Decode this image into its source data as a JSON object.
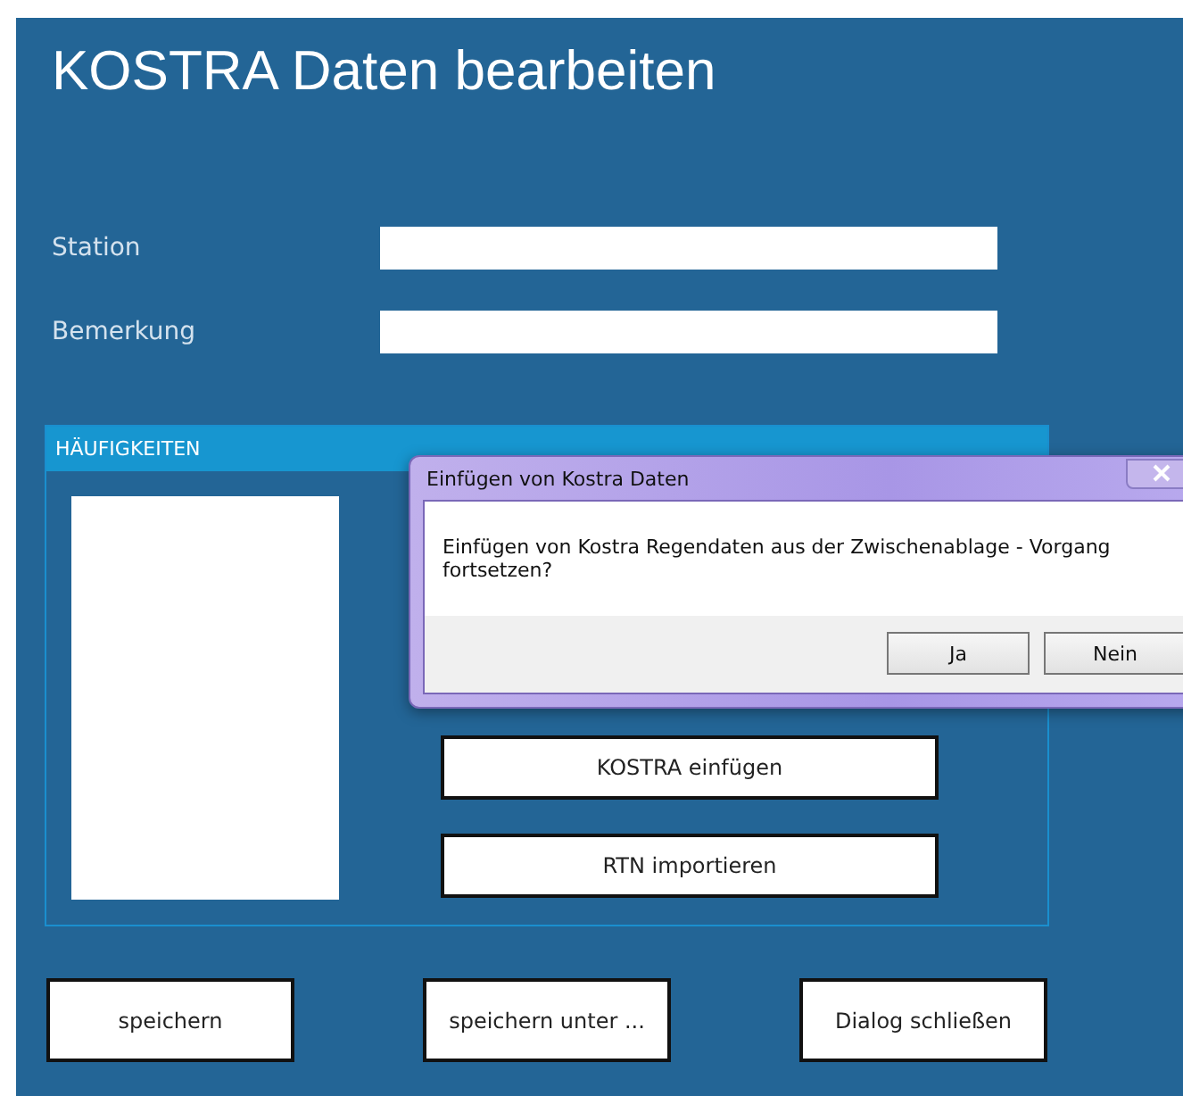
{
  "title": "KOSTRA Daten bearbeiten",
  "fields": [
    {
      "label": "Station"
    },
    {
      "label": "Bemerkung"
    }
  ],
  "group": {
    "title": "HÄUFIGKEITEN",
    "buttons": [
      "KOSTRA einfügen",
      "RTN importieren"
    ]
  },
  "buttons": [
    "speichern",
    "speichern unter ...",
    "Dialog schließen"
  ],
  "dialog": {
    "title": "Einfügen von Kostra Daten",
    "message": "Einfügen von Kostra Regendaten aus der Zwischenablage - Vorgang fortsetzen?",
    "buttons": [
      "Ja",
      "Nein"
    ]
  }
}
